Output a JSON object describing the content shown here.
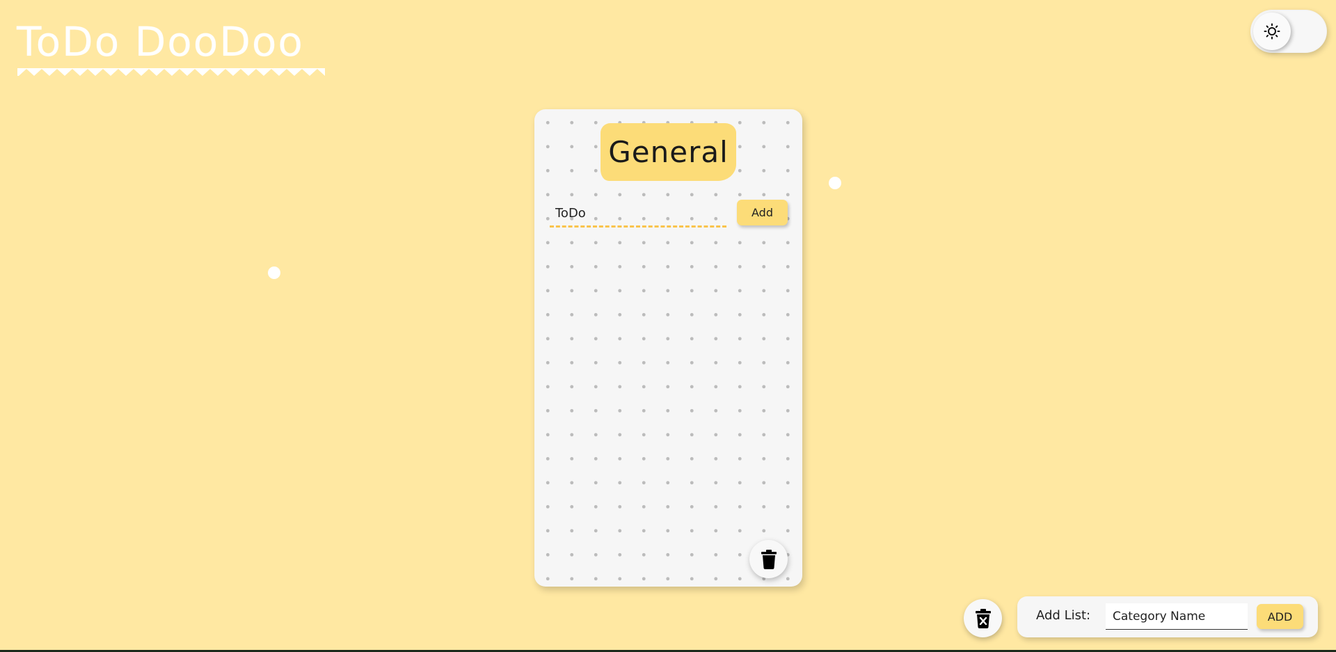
{
  "app": {
    "title": "ToDo DooDoo"
  },
  "theme_toggle": {
    "icon": "sun-icon",
    "mode": "light"
  },
  "lists": [
    {
      "title": "General",
      "input_placeholder": "ToDo",
      "add_label": "Add",
      "delete_icon": "trash-icon"
    }
  ],
  "footer": {
    "delete_all_icon": "trash-x-icon",
    "add_list_label": "Add List:",
    "category_placeholder": "Category Name",
    "add_button_label": "ADD"
  },
  "colors": {
    "background": "#ffe8a2",
    "accent": "#fcdc78",
    "card": "#f6f6f6",
    "dashed_underline": "#f9c44c"
  }
}
